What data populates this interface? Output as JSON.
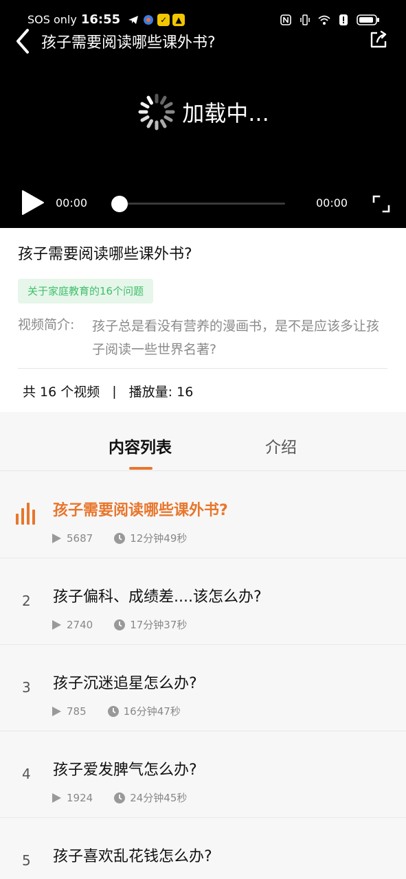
{
  "status_bar": {
    "carrier": "SOS only",
    "time": "16:55"
  },
  "player": {
    "title": "孩子需要阅读哪些课外书?",
    "loading_text": "加载中...",
    "current_time": "00:00",
    "total_time": "00:00",
    "progress": 0
  },
  "info": {
    "title": "孩子需要阅读哪些课外书?",
    "tag": "关于家庭教育的16个问题",
    "intro_label": "视频简介:",
    "intro_text": "孩子总是看没有营养的漫画书，是不是应该多让孩子阅读一些世界名著?",
    "stats_count": "共 16 个视频",
    "stats_sep": "|",
    "stats_views": "播放量: 16"
  },
  "tabs": {
    "list_label": "内容列表",
    "intro_label": "介绍"
  },
  "list": [
    {
      "index": "",
      "title": "孩子需要阅读哪些课外书?",
      "plays": "5687",
      "duration": "12分钟49秒"
    },
    {
      "index": "2",
      "title": "孩子偏科、成绩差....该怎么办?",
      "plays": "2740",
      "duration": "17分钟37秒"
    },
    {
      "index": "3",
      "title": "孩子沉迷追星怎么办?",
      "plays": "785",
      "duration": "16分钟47秒"
    },
    {
      "index": "4",
      "title": "孩子爱发脾气怎么办?",
      "plays": "1924",
      "duration": "24分钟45秒"
    },
    {
      "index": "5",
      "title": "孩子喜欢乱花钱怎么办?",
      "plays": "",
      "duration": ""
    }
  ],
  "colors": {
    "accent": "#e8762c",
    "tag_bg": "#e6f6ea",
    "tag_text": "#3fbf6b"
  }
}
